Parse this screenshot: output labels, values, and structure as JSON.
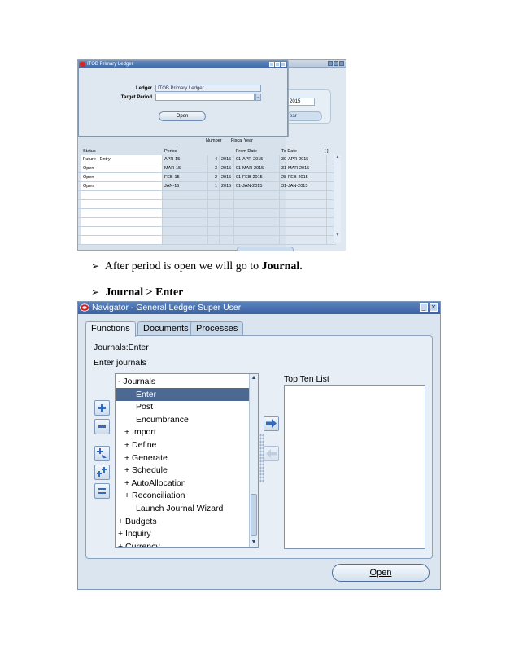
{
  "screenshot1": {
    "form_title": "ITOB Primary Ledger",
    "ledger_label": "Ledger",
    "ledger_value": "ITOB Primary Ledger",
    "target_period_label": "Target Period",
    "target_period_value": "",
    "lov_symbol": "...",
    "open_button": "Open",
    "back_year_value": "2015",
    "back_button_fragment": "ear",
    "columns": {
      "status": "Status",
      "period": "Period",
      "number": "Number",
      "fiscal_year": "Fiscal Year",
      "from_date": "From Date",
      "to_date": "To Date",
      "flex": "[ ]"
    },
    "rows": [
      {
        "status": "Future - Entry",
        "period": "APR-15",
        "number": "4",
        "year": "2015",
        "from": "01-APR-2015",
        "to": "30-APR-2015"
      },
      {
        "status": "Open",
        "period": "MAR-15",
        "number": "3",
        "year": "2015",
        "from": "01-MAR-2015",
        "to": "31-MAR-2015"
      },
      {
        "status": "Open",
        "period": "FEB-15",
        "number": "2",
        "year": "2015",
        "from": "01-FEB-2015",
        "to": "28-FEB-2015"
      },
      {
        "status": "Open",
        "period": "JAN-15",
        "number": "1",
        "year": "2015",
        "from": "01-JAN-2015",
        "to": "31-JAN-2015"
      }
    ]
  },
  "bullets": {
    "b1_text": "After period is open we will go to ",
    "b1_bold": "Journal.",
    "b2_bold": "Journal > Enter"
  },
  "screenshot2": {
    "title": "Navigator - General Ledger Super User",
    "tabs": [
      "Functions",
      "Documents",
      "Processes"
    ],
    "active_tab": "Functions",
    "path": "Journals:Enter",
    "description": "Enter journals",
    "top_ten_label": "Top Ten List",
    "tree": [
      {
        "label": "-  Journals",
        "level": 0,
        "selected": false
      },
      {
        "label": "Enter",
        "level": 2,
        "selected": true
      },
      {
        "label": "Post",
        "level": 2,
        "selected": false
      },
      {
        "label": "Encumbrance",
        "level": 2,
        "selected": false
      },
      {
        "label": "+  Import",
        "level": 1,
        "selected": false
      },
      {
        "label": "+  Define",
        "level": 1,
        "selected": false
      },
      {
        "label": "+  Generate",
        "level": 1,
        "selected": false
      },
      {
        "label": "+  Schedule",
        "level": 1,
        "selected": false
      },
      {
        "label": "+  AutoAllocation",
        "level": 1,
        "selected": false
      },
      {
        "label": "+  Reconciliation",
        "level": 1,
        "selected": false
      },
      {
        "label": "Launch Journal Wizard",
        "level": 2,
        "selected": false
      },
      {
        "label": "+  Budgets",
        "level": 0,
        "selected": false
      },
      {
        "label": "+  Inquiry",
        "level": 0,
        "selected": false
      },
      {
        "label": "+  Currency",
        "level": 0,
        "selected": false
      }
    ],
    "open_button": "Open",
    "icons": [
      "expand-icon",
      "collapse-icon",
      "expand-branch-icon",
      "expand-all-icon",
      "collapse-all-icon",
      "add-to-list-icon",
      "remove-from-list-icon"
    ]
  }
}
